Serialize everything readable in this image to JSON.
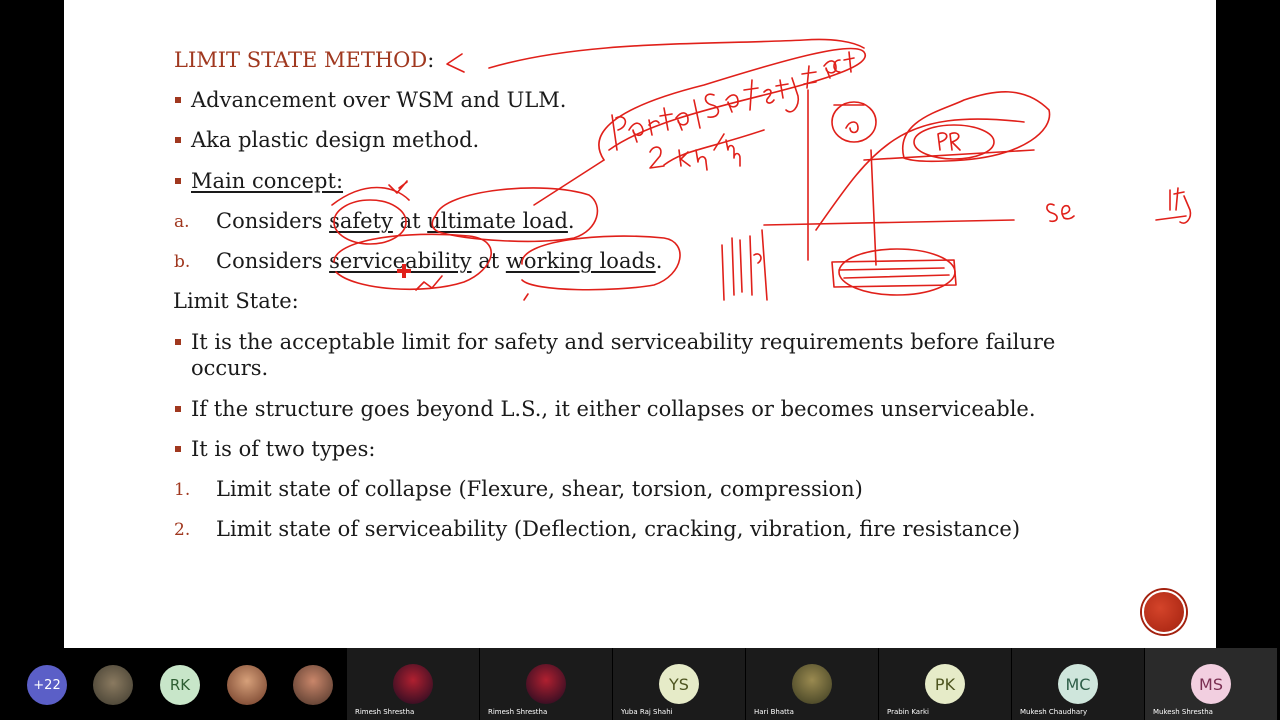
{
  "slide": {
    "title": "LIMIT STATE METHOD",
    "title_colon": ":",
    "bullets_top": [
      "Advancement over WSM and ULM.",
      "Aka plastic design method."
    ],
    "main_concept": "Main concept:",
    "concept_items": [
      {
        "marker": "a.",
        "prefix": "Considers ",
        "u1": "safety",
        "mid": " at ",
        "u2": "ultimate load",
        "end": "."
      },
      {
        "marker": "b.",
        "prefix": "Considers ",
        "u1": "serviceability",
        "mid": " at ",
        "u2": "working loads",
        "end": "."
      }
    ],
    "limit_state_heading": "Limit State:",
    "ls_bullets": [
      {
        "line1": "It is the acceptable limit for safety and serviceability requirements before failure",
        "line2": "occurs."
      },
      {
        "line1": "If the structure goes beyond L.S., it either collapses or becomes unserviceable."
      },
      {
        "line1": "It is of two types:"
      }
    ],
    "types": [
      {
        "marker": "1.",
        "text": "Limit state of collapse (Flexure, shear, torsion, compression)"
      },
      {
        "marker": "2.",
        "text": "Limit state of serviceability (Deflection, cracking, vibration, fire resistance)"
      }
    ]
  },
  "annotations": {
    "partial": "Partial safety factor",
    "load": "2 kN/m",
    "pr": "PR",
    "se": "se",
    "ity": "ity",
    "ink_color": "#e0201a"
  },
  "participants": {
    "overflow_count": "+22",
    "small_avatars": [
      {
        "initials": "",
        "kind": "photo"
      },
      {
        "initials": "RK",
        "kind": "initials",
        "color": "#c8e6c9"
      },
      {
        "initials": "",
        "kind": "photo"
      },
      {
        "initials": "",
        "kind": "photo"
      }
    ],
    "tiles": [
      {
        "name": "Rimesh Shrestha",
        "initials": "",
        "kind": "photo"
      },
      {
        "name": "Rimesh Shrestha",
        "initials": "",
        "kind": "photo"
      },
      {
        "name": "Yuba Raj Shahi",
        "initials": "YS",
        "kind": "initials",
        "color": "#e6ebc8"
      },
      {
        "name": "Hari Bhatta",
        "initials": "",
        "kind": "photo"
      },
      {
        "name": "Prabin Karki",
        "initials": "PK",
        "kind": "initials",
        "color": "#e6ebc8"
      },
      {
        "name": "Mukesh Chaudhary",
        "initials": "MC",
        "kind": "initials",
        "color": "#cfe6dc"
      },
      {
        "name": "Mukesh Shrestha",
        "initials": "MS",
        "kind": "initials",
        "color": "#f2cfe0"
      }
    ]
  }
}
